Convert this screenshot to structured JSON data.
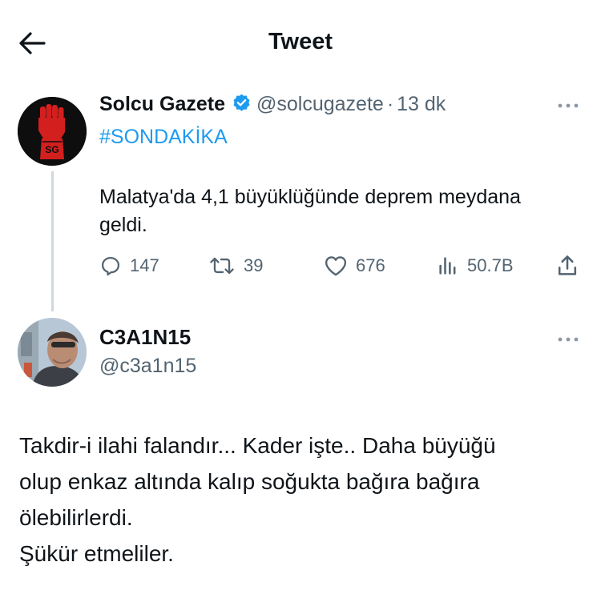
{
  "header": {
    "title": "Tweet"
  },
  "tweet": {
    "author_name": "Solcu Gazete",
    "author_handle": "@solcugazete",
    "separator": "·",
    "time": "13 dk",
    "avatar_text": "SG",
    "hashtag": "#SONDAKİKA",
    "body": "Malatya'da 4,1 büyüklüğünde deprem meydana geldi.",
    "replies": "147",
    "retweets": "39",
    "likes": "676",
    "views": "50.7B"
  },
  "reply": {
    "author_name": "C3A1N15",
    "author_handle": "@c3a1n15",
    "lines": [
      "Takdir-i ilahi falandır... Kader işte.. Daha büyüğü",
      "olup enkaz altında kalıp soğukta bağıra bağıra",
      "ölebilirlerdi.",
      "Şükür etmeliler."
    ]
  },
  "colors": {
    "accent": "#1d9bf0",
    "muted": "#536471",
    "text": "#0f1419",
    "thread_line": "#cfd9de"
  },
  "icons": [
    "back-arrow-icon",
    "verified-badge-icon",
    "more-icon",
    "reply-icon",
    "retweet-icon",
    "like-icon",
    "views-icon",
    "share-icon"
  ]
}
